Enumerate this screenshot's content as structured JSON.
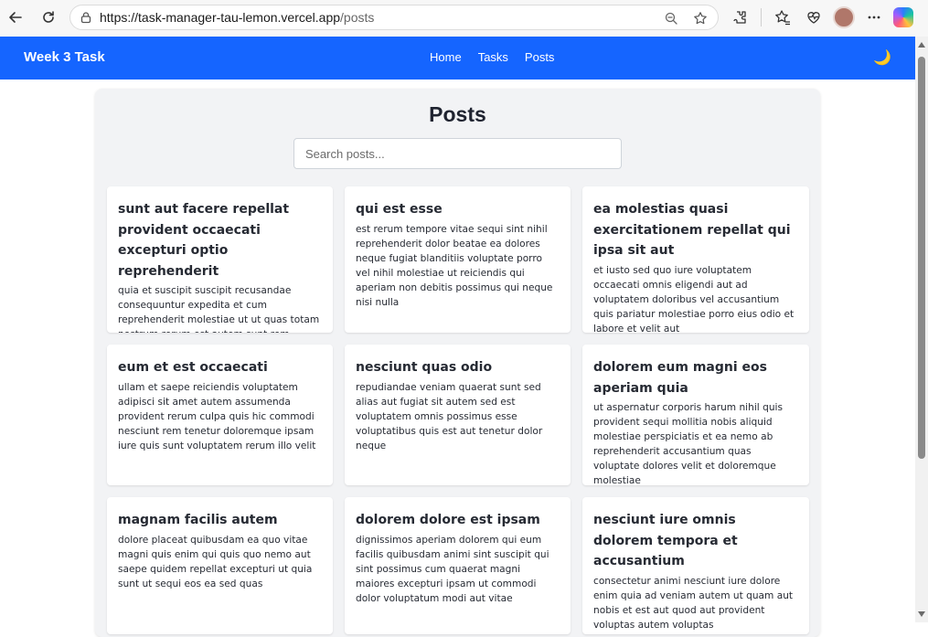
{
  "browser": {
    "url_host": "https://task-manager-tau-lemon.vercel.app",
    "url_path": "/posts"
  },
  "app": {
    "brand": "Week 3 Task",
    "nav": [
      "Home",
      "Tasks",
      "Posts"
    ],
    "theme_toggle_icon": "moon-icon"
  },
  "page": {
    "title": "Posts",
    "search_placeholder": "Search posts..."
  },
  "posts": [
    {
      "title": "sunt aut facere repellat provident occaecati excepturi optio reprehenderit",
      "body": "quia et suscipit suscipit recusandae consequuntur expedita et cum reprehenderit molestiae ut ut quas totam nostrum rerum est autem sunt rem eveniet architecto"
    },
    {
      "title": "qui est esse",
      "body": "est rerum tempore vitae sequi sint nihil reprehenderit dolor beatae ea dolores neque fugiat blanditiis voluptate porro vel nihil molestiae ut reiciendis qui aperiam non debitis possimus qui neque nisi nulla"
    },
    {
      "title": "ea molestias quasi exercitationem repellat qui ipsa sit aut",
      "body": "et iusto sed quo iure voluptatem occaecati omnis eligendi aut ad voluptatem doloribus vel accusantium quis pariatur molestiae porro eius odio et labore et velit aut"
    },
    {
      "title": "eum et est occaecati",
      "body": "ullam et saepe reiciendis voluptatem adipisci sit amet autem assumenda provident rerum culpa quis hic commodi nesciunt rem tenetur doloremque ipsam iure quis sunt voluptatem rerum illo velit"
    },
    {
      "title": "nesciunt quas odio",
      "body": "repudiandae veniam quaerat sunt sed alias aut fugiat sit autem sed est voluptatem omnis possimus esse voluptatibus quis est aut tenetur dolor neque"
    },
    {
      "title": "dolorem eum magni eos aperiam quia",
      "body": "ut aspernatur corporis harum nihil quis provident sequi mollitia nobis aliquid molestiae perspiciatis et ea nemo ab reprehenderit accusantium quas voluptate dolores velit et doloremque molestiae"
    },
    {
      "title": "magnam facilis autem",
      "body": "dolore placeat quibusdam ea quo vitae magni quis enim qui quis quo nemo aut saepe quidem repellat excepturi ut quia sunt ut sequi eos ea sed quas"
    },
    {
      "title": "dolorem dolore est ipsam",
      "body": "dignissimos aperiam dolorem qui eum facilis quibusdam animi sint suscipit qui sint possimus cum quaerat magni maiores excepturi ipsam ut commodi dolor voluptatum modi aut vitae"
    },
    {
      "title": "nesciunt iure omnis dolorem tempora et accusantium",
      "body": "consectetur animi nesciunt iure dolore enim quia ad veniam autem ut quam aut nobis et est aut quod aut provident voluptas autem voluptas"
    }
  ],
  "colors": {
    "navbar": "#1565ff",
    "panel": "#f2f3f5",
    "text": "#262a33"
  }
}
